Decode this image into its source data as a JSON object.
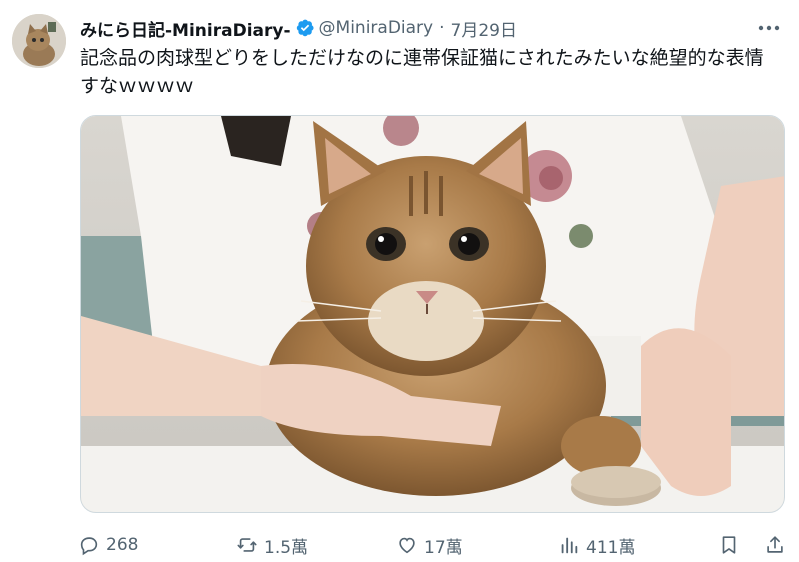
{
  "author": {
    "display_name": "みにら日記-MiniraDiary-",
    "handle": "@MiniraDiary",
    "separator": "·",
    "date": "7月29日",
    "avatar_icon": "cat-avatar"
  },
  "tweet": {
    "text": "記念品の肉球型どりをしただけなのに連帯保証猫にされたみたいな絶望的な表情すなｗｗｗｗ"
  },
  "media": {
    "subject_icon": "cat-photo"
  },
  "actions": {
    "replies": "268",
    "reposts": "1.5萬",
    "likes": "17萬",
    "views": "411萬"
  },
  "colors": {
    "text_primary": "#0f1419",
    "text_secondary": "#536471",
    "verified_blue": "#1d9bf0"
  }
}
